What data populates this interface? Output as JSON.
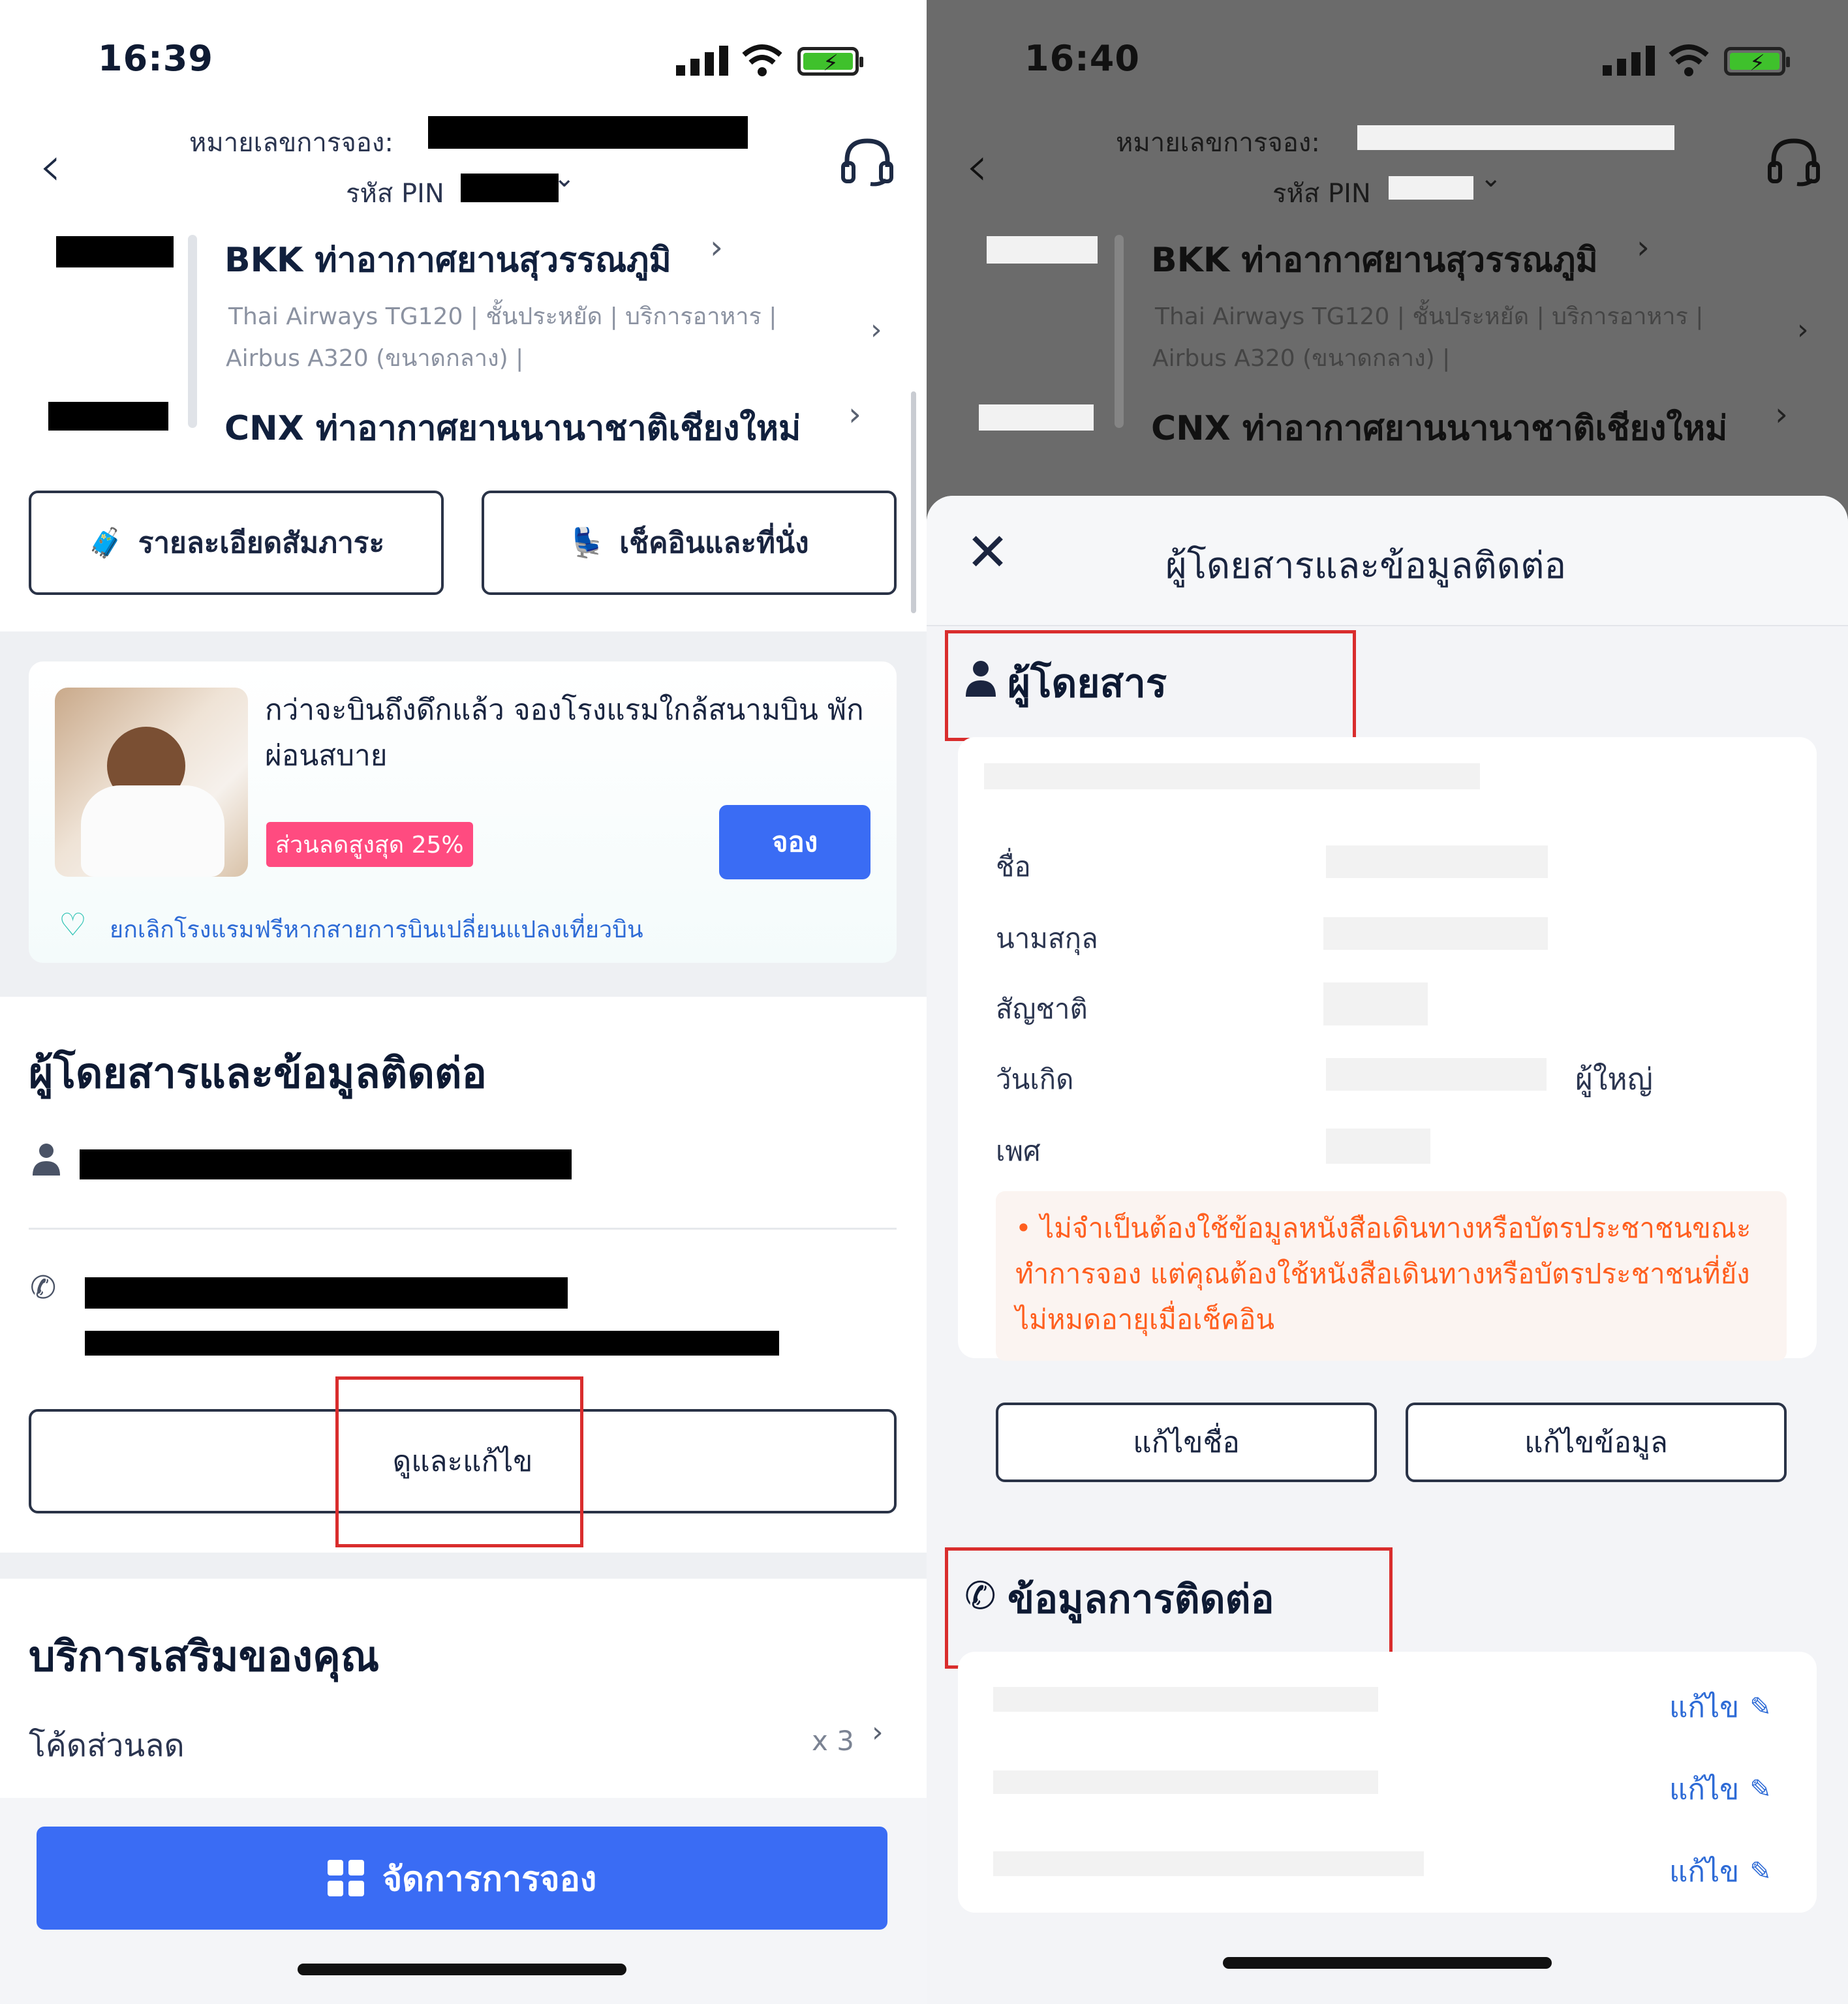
{
  "left": {
    "status": {
      "time": "16:39"
    },
    "header": {
      "booking_label": "หมายเลขการจอง:",
      "pin_label": "รหัส PIN",
      "chevron": "⌄"
    },
    "route": {
      "from": "BKK  ท่าอากาศยานสุวรรณภูมิ",
      "flight_line1": "Thai Airways TG120 | ชั้นประหยัด | บริการอาหาร |",
      "flight_line2": "Airbus A320 (ขนาดกลาง) |",
      "to": "CNX  ท่าอากาศยานนานาชาติเชียงใหม่"
    },
    "buttons": {
      "baggage": "รายละเอียดสัมภาระ",
      "checkin": "เช็คอินและที่นั่ง"
    },
    "promo": {
      "title": "กว่าจะบินถึงดึกแล้ว จองโรงแรมใกล้สนามบิน พักผ่อนสบาย",
      "badge": "ส่วนลดสูงสุด 25%",
      "book_button": "จอง",
      "note": "ยกเลิกโรงแรมฟรีหากสายการบินเปลี่ยนแปลงเที่ยวบิน"
    },
    "passengers": {
      "title": "ผู้โดยสารและข้อมูลติดต่อ",
      "view_edit": "ดูและแก้ไข"
    },
    "extras": {
      "title": "บริการเสริมของคุณ",
      "discount_label": "โค้ดส่วนลด",
      "discount_count": "x 3"
    },
    "manage_button": "จัดการการจอง"
  },
  "right": {
    "status": {
      "time": "16:40"
    },
    "header": {
      "booking_label": "หมายเลขการจอง:",
      "pin_label": "รหัส PIN",
      "chevron": "⌄"
    },
    "route": {
      "from": "BKK  ท่าอากาศยานสุวรรณภูมิ",
      "flight_line1": "Thai Airways TG120 | ชั้นประหยัด | บริการอาหาร |",
      "flight_line2": "Airbus A320 (ขนาดกลาง) |",
      "to": "CNX  ท่าอากาศยานนานาชาติเชียงใหม่"
    },
    "sheet": {
      "title": "ผู้โดยสารและข้อมูลติดต่อ",
      "passenger_section": "ผู้โดยสาร",
      "fields": {
        "first_name": "ชื่อ",
        "last_name": "นามสกุล",
        "nationality": "สัญชาติ",
        "birthday": "วันเกิด",
        "gender": "เพศ"
      },
      "age_type": "ผู้ใหญ่",
      "warning": "• ไม่จำเป็นต้องใช้ข้อมูลหนังสือเดินทางหรือบัตรประชาชนขณะทำการจอง แต่คุณต้องใช้หนังสือเดินทางหรือบัตรประชาชนที่ยังไม่หมดอายุเมื่อเช็คอิน",
      "edit_name": "แก้ไขชื่อ",
      "edit_info": "แก้ไขข้อมูล",
      "contact_section": "ข้อมูลการติดต่อ",
      "edit_link": "แก้ไข"
    }
  },
  "colors": {
    "accent": "#3a6cf4",
    "highlight": "#d92d2d",
    "warning": "#ff5f1f",
    "badge": "#ff4b80"
  }
}
